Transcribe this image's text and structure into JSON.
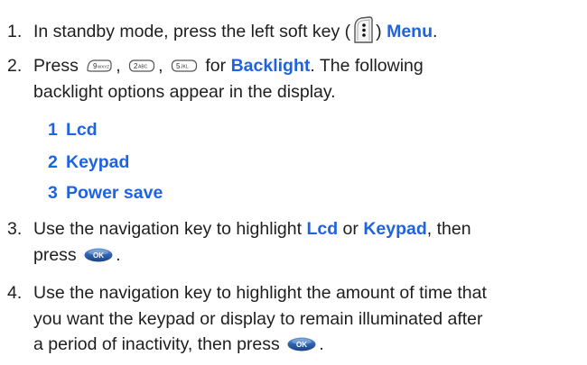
{
  "steps": [
    {
      "number": "1.",
      "text_before": "In standby mode, press the left soft key (",
      "text_after": ")",
      "emphasis": "Menu",
      "icon": "left-soft-key-icon"
    },
    {
      "number": "2.",
      "text_press": "Press",
      "sep1": ",",
      "sep2": ",",
      "keys": [
        "9wxyz-key-icon",
        "2abc-key-icon",
        "5jkl-key-icon"
      ],
      "text_for": "for",
      "emphasis": "Backlight",
      "text_line1_end": ". The following",
      "text_line2": "backlight options appear in the display."
    },
    {
      "number": "3.",
      "line1_before": "Use the navigation key to highlight",
      "emphasis1": "Lcd",
      "text_or": "or",
      "emphasis2": "Keypad",
      "line1_after": ", then",
      "line2": "press",
      "line2_end": ".",
      "icon": "ok-key-icon"
    },
    {
      "number": "4.",
      "line1": "Use the navigation key to highlight the amount of time that",
      "line2": "you want the keypad or display to remain illuminated after",
      "line3": "a period of inactivity, then press",
      "line3_end": ".",
      "icon": "ok-key-icon"
    }
  ],
  "options": [
    {
      "number": "1",
      "label": "Lcd"
    },
    {
      "number": "2",
      "label": "Keypad"
    },
    {
      "number": "3",
      "label": "Power save"
    }
  ],
  "colors": {
    "emphasis": "#1f63e0",
    "text": "#1e1e1e"
  }
}
